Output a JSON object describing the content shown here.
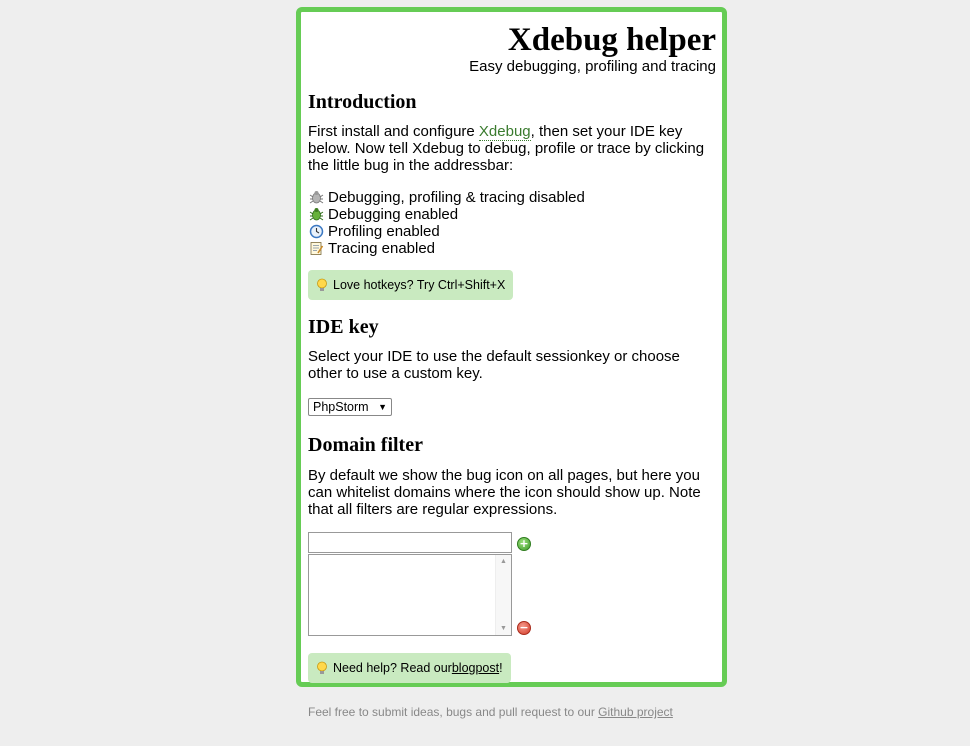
{
  "header": {
    "title": "Xdebug helper",
    "subtitle": "Easy debugging, profiling and tracing"
  },
  "introduction": {
    "heading": "Introduction",
    "text_before_link": "First install and configure ",
    "link_text": "Xdebug",
    "text_after_link": ", then set your IDE key below. Now tell Xdebug to debug, profile or trace by clicking the little bug in the addressbar:",
    "states": [
      {
        "icon": "bug-disabled-icon",
        "label": "Debugging, profiling & tracing disabled"
      },
      {
        "icon": "bug-enabled-icon",
        "label": "Debugging enabled"
      },
      {
        "icon": "clock-icon",
        "label": "Profiling enabled"
      },
      {
        "icon": "notepad-icon",
        "label": "Tracing enabled"
      }
    ],
    "hotkey_hint": "Love hotkeys? Try Ctrl+Shift+X"
  },
  "ide_key": {
    "heading": "IDE key",
    "text": "Select your IDE to use the default sessionkey or choose other to use a custom key.",
    "selected": "PhpStorm"
  },
  "domain_filter": {
    "heading": "Domain filter",
    "text": "By default we show the bug icon on all pages, but here you can whitelist domains where the icon should show up. Note that all filters are regular expressions.",
    "input_value": "",
    "list_items": []
  },
  "help": {
    "text_before": "Need help? Read our ",
    "link": "blogpost",
    "text_after": "!"
  },
  "footer": {
    "text_before": "Feel free to submit ideas, bugs and pull request to our ",
    "link": "Github project"
  },
  "colors": {
    "panel_border": "#66cc55",
    "hint_background": "#c9eac0",
    "link": "#3a7b2e",
    "page_background": "#eeeeee"
  }
}
